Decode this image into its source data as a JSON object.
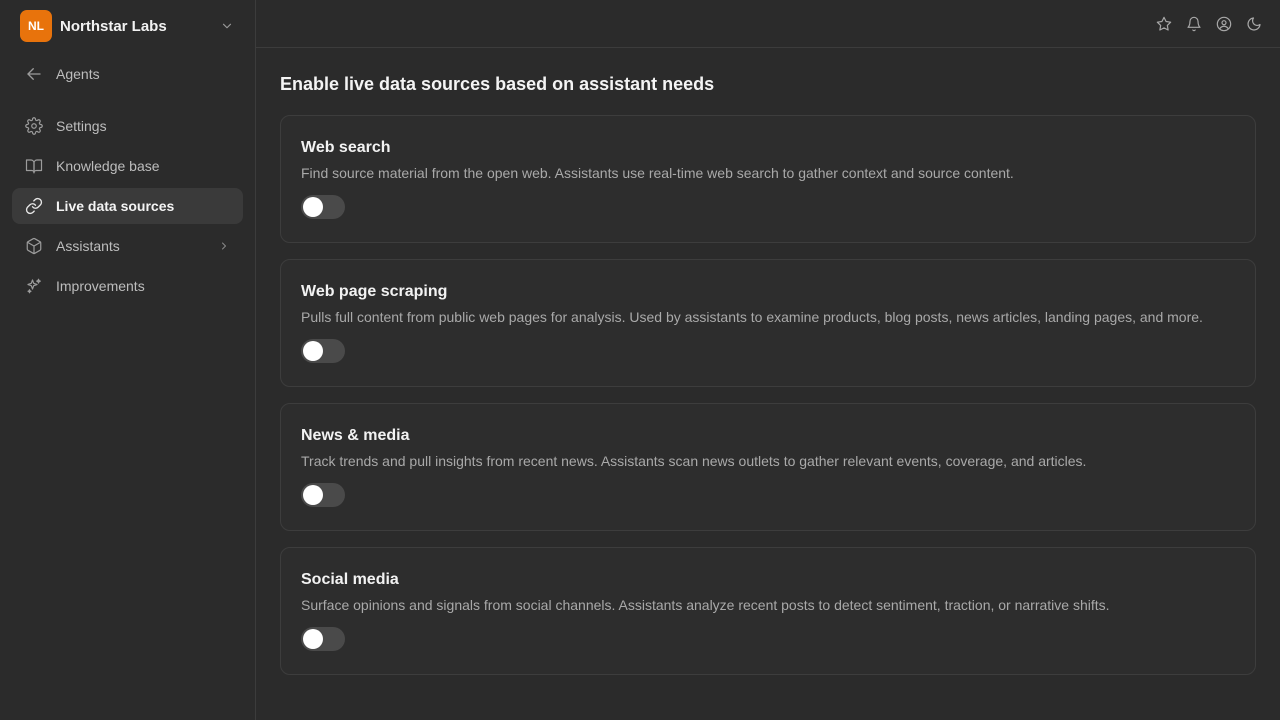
{
  "sidebar": {
    "org": {
      "initials": "NL",
      "name": "Northstar Labs",
      "avatar_color": "#e8730c"
    },
    "back": {
      "label": "Agents",
      "icon": "arrow-left-icon"
    },
    "items": [
      {
        "label": "Settings",
        "icon": "gear-icon",
        "active": false
      },
      {
        "label": "Knowledge base",
        "icon": "book-icon",
        "active": false
      },
      {
        "label": "Live data sources",
        "icon": "link-icon",
        "active": true
      },
      {
        "label": "Assistants",
        "icon": "cube-icon",
        "active": false,
        "has_submenu": true
      },
      {
        "label": "Improvements",
        "icon": "sparkles-icon",
        "active": false
      }
    ]
  },
  "topbar": {
    "icons": [
      "star-icon",
      "bell-icon",
      "user-circle-icon",
      "moon-icon"
    ]
  },
  "main": {
    "title": "Enable live data sources based on assistant needs",
    "sources": [
      {
        "title": "Web search",
        "description": "Find source material from the open web. Assistants use real-time web search to gather context and source content.",
        "enabled": false
      },
      {
        "title": "Web page scraping",
        "description": "Pulls full content from public web pages for analysis. Used by assistants to examine products, blog posts, news articles, landing pages, and more.",
        "enabled": false
      },
      {
        "title": "News & media",
        "description": "Track trends and pull insights from recent news. Assistants scan news outlets to gather relevant events, coverage, and articles.",
        "enabled": false
      },
      {
        "title": "Social media",
        "description": "Surface opinions and signals from social channels. Assistants analyze recent posts to detect sentiment, traction, or narrative shifts.",
        "enabled": false
      }
    ]
  }
}
